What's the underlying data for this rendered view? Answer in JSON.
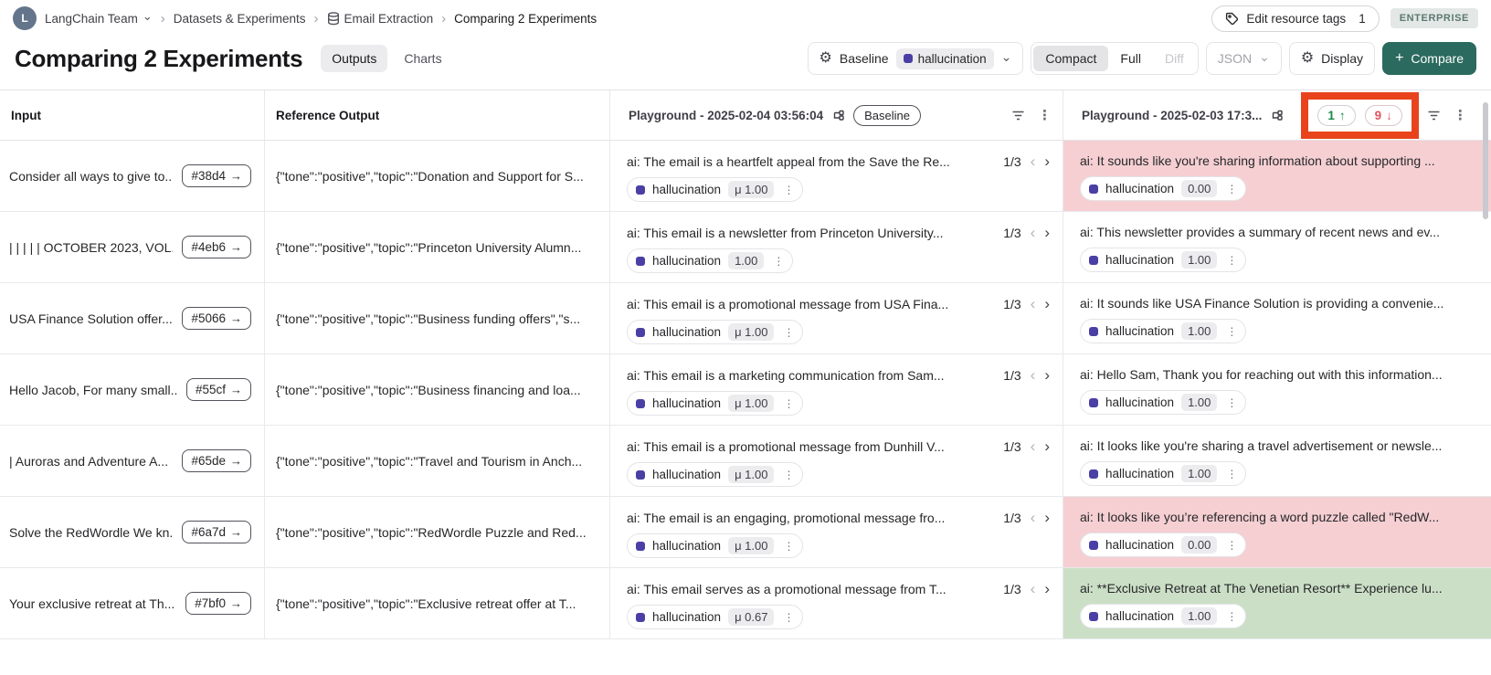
{
  "icons": {
    "gear": "⚙",
    "caret_down": "⌄",
    "breadcrumb_sep": "›",
    "arrow_right": "→",
    "chevron_left": "‹",
    "chevron_right": "›",
    "kebab": "⋮",
    "arrow_up": "↑",
    "arrow_down": "↓",
    "plus": "+"
  },
  "colors": {
    "accent_teal": "#2b6a5e",
    "feedback_purple": "#4a3fa5",
    "regression_bg": "#f5cfd2",
    "improvement_bg": "#cbdfc6",
    "annotation_red": "#e8431c"
  },
  "breadcrumb": {
    "team": "LangChain Team",
    "items": [
      "Datasets & Experiments",
      "Email Extraction",
      "Comparing 2 Experiments"
    ]
  },
  "topbar": {
    "edit_tags_label": "Edit resource tags",
    "edit_tags_count": "1",
    "plan_badge": "ENTERPRISE"
  },
  "header": {
    "title": "Comparing 2 Experiments",
    "tabs": [
      {
        "label": "Outputs"
      },
      {
        "label": "Charts"
      }
    ],
    "baseline_label": "Baseline",
    "baseline_feedback": "hallucination",
    "mode_compact": "Compact",
    "mode_full": "Full",
    "mode_diff": "Diff",
    "json_label": "JSON",
    "display_label": "Display",
    "compare_label": "Compare"
  },
  "table": {
    "feedback_key": "hallucination",
    "header": {
      "col_input": "Input",
      "col_reference": "Reference Output",
      "exp1_name": "Playground - 2025-02-04 03:56:04",
      "exp1_badge": "Baseline",
      "exp2_name": "Playground - 2025-02-03 17:3...",
      "exp2_improved": "1",
      "exp2_regressed": "9"
    },
    "rows": [
      {
        "input": "Consider all ways to give to...",
        "id": "#38d4",
        "reference": "{\"tone\":\"positive\",\"topic\":\"Donation and Support for S...",
        "exp1": {
          "text": "ai: The email is a heartfelt appeal from the Save the Re...",
          "pager": "1/3",
          "score": "μ 1.00"
        },
        "exp2": {
          "text": "ai: It sounds like you're sharing information about supporting ...",
          "score": "0.00",
          "bg": "pink"
        }
      },
      {
        "input": "| | | | | OCTOBER 2023, VOL...",
        "id": "#4eb6",
        "reference": "{\"tone\":\"positive\",\"topic\":\"Princeton University Alumn...",
        "exp1": {
          "text": "ai: This email is a newsletter from Princeton University...",
          "pager": "1/3",
          "score": "1.00"
        },
        "exp2": {
          "text": "ai: This newsletter provides a summary of recent news and ev...",
          "score": "1.00",
          "bg": ""
        }
      },
      {
        "input": "USA Finance Solution offer...",
        "id": "#5066",
        "reference": "{\"tone\":\"positive\",\"topic\":\"Business funding offers\",\"s...",
        "exp1": {
          "text": "ai: This email is a promotional message from USA Fina...",
          "pager": "1/3",
          "score": "μ 1.00"
        },
        "exp2": {
          "text": "ai: It sounds like USA Finance Solution is providing a convenie...",
          "score": "1.00",
          "bg": ""
        }
      },
      {
        "input": "Hello Jacob, For many small...",
        "id": "#55cf",
        "reference": "{\"tone\":\"positive\",\"topic\":\"Business financing and loa...",
        "exp1": {
          "text": "ai: This email is a marketing communication from Sam...",
          "pager": "1/3",
          "score": "μ 1.00"
        },
        "exp2": {
          "text": "ai: Hello Sam, Thank you for reaching out with this information...",
          "score": "1.00",
          "bg": ""
        }
      },
      {
        "input": "| Auroras and Adventure A...",
        "id": "#65de",
        "reference": "{\"tone\":\"positive\",\"topic\":\"Travel and Tourism in Anch...",
        "exp1": {
          "text": "ai: This email is a promotional message from Dunhill V...",
          "pager": "1/3",
          "score": "μ 1.00"
        },
        "exp2": {
          "text": "ai: It looks like you're sharing a travel advertisement or newsle...",
          "score": "1.00",
          "bg": ""
        }
      },
      {
        "input": "Solve the RedWordle We kn...",
        "id": "#6a7d",
        "reference": "{\"tone\":\"positive\",\"topic\":\"RedWordle Puzzle and Red...",
        "exp1": {
          "text": "ai: The email is an engaging, promotional message fro...",
          "pager": "1/3",
          "score": "μ 1.00"
        },
        "exp2": {
          "text": "ai: It looks like you’re referencing a word puzzle called \"RedW...",
          "score": "0.00",
          "bg": "pink"
        }
      },
      {
        "input": "Your exclusive retreat at Th...",
        "id": "#7bf0",
        "reference": "{\"tone\":\"positive\",\"topic\":\"Exclusive retreat offer at T...",
        "exp1": {
          "text": "ai: This email serves as a promotional message from T...",
          "pager": "1/3",
          "score": "μ 0.67"
        },
        "exp2": {
          "text": "ai: **Exclusive Retreat at The Venetian Resort** Experience lu...",
          "score": "1.00",
          "bg": "green"
        }
      }
    ]
  }
}
